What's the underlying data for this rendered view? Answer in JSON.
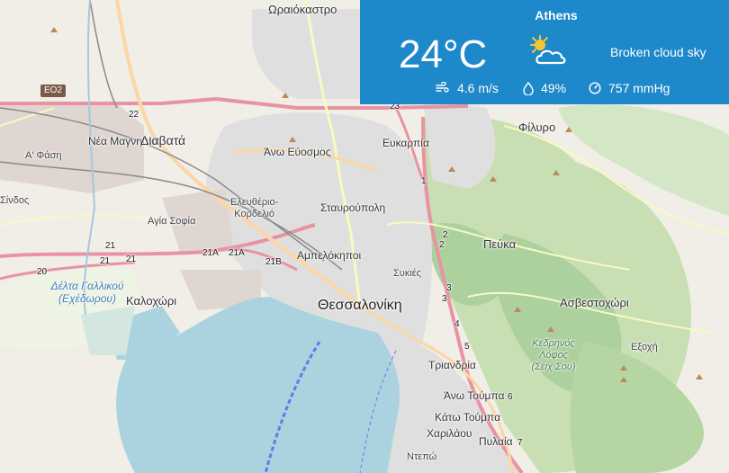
{
  "weather": {
    "city": "Athens",
    "temperature": "24°C",
    "condition_icon": "sun-behind-cloud-icon",
    "description": "Broken cloud sky",
    "wind": "4.6 m/s",
    "humidity": "49%",
    "pressure": "757 mmHg",
    "colors": {
      "panel": "#1182c8",
      "sun": "#f7c531"
    }
  },
  "map": {
    "colors": {
      "land": "#f1eee8",
      "sea": "#aad3df",
      "urban": "#e0dfdf",
      "forest": "#add19e",
      "motorway": "#e892a2",
      "primary": "#fcd6a4",
      "secondary": "#f7fabf"
    },
    "labels": {
      "oraiokastro": "Ωραιόκαστρο",
      "filyro": "Φίλυρο",
      "nea_magnisia": "Νέα Μαγνησία",
      "diavata": "Διαβατά",
      "ano_eyosmos": "Άνω Εύοσμος",
      "efkarpia": "Ευκαρπία",
      "a_fasi": "Α' Φάση",
      "sindos": "Σίνδος",
      "eleftherio": "Ελευθέριο-\nΚορδελιό",
      "stavroupoli": "Σταυρούπολη",
      "agia_sofia": "Αγία Σοφία",
      "pefka": "Πεύκα",
      "ampelokipoi": "Αμπελόκηποι",
      "sykies": "Συκιές",
      "kalochori": "Καλοχώρι",
      "thessaloniki": "Θεσσαλονίκη",
      "asvestochori": "Ασβεστοχώρι",
      "delta": "Δέλτα Γαλλικού\n(Εχέδωρου)",
      "kedrinos": "Κεδρηνός\nΛόφος\n(Σέιχ Σου)",
      "exochi": "Εξοχή",
      "triandria": "Τριανδρία",
      "ano_toumpa": "Άνω Τούμπα",
      "kato_toumpa": "Κάτω Τούμπα",
      "charilaou": "Χαριλάου",
      "pylaia": "Πυλαία",
      "ntepo": "Ντεπώ",
      "eo2": "ΕΟ2"
    },
    "road_refs": [
      "22",
      "21",
      "21",
      "21",
      "20",
      "21A",
      "21A",
      "21B",
      "23",
      "2",
      "2",
      "3",
      "3",
      "4",
      "5",
      "6",
      "7",
      "1"
    ]
  }
}
